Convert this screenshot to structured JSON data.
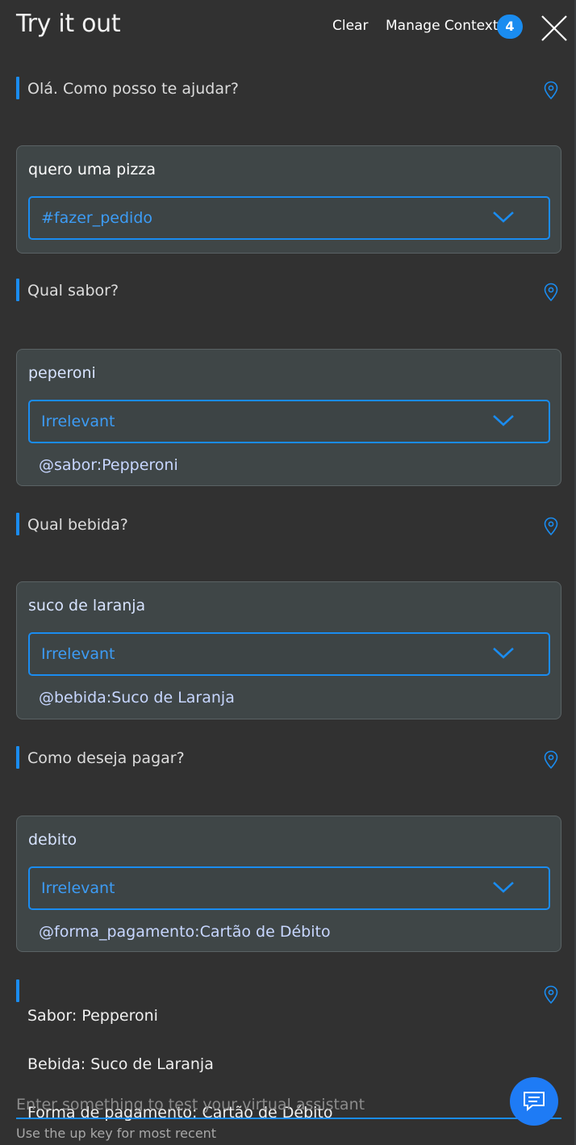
{
  "header": {
    "title": "Try it out",
    "clear_label": "Clear",
    "manage_context_label": "Manage Context",
    "context_count": "4"
  },
  "conversation": {
    "bot_messages": [
      "Olá. Como posso te ajudar?",
      "Qual sabor?",
      "Qual bebida?",
      "Como deseja pagar?"
    ],
    "user_inputs": [
      {
        "text": "quero uma pizza",
        "intent": "#fazer_pedido",
        "entity": ""
      },
      {
        "text": "peperoni",
        "intent": "Irrelevant",
        "entity": "@sabor:Pepperoni"
      },
      {
        "text": "suco de laranja",
        "intent": "Irrelevant",
        "entity": "@bebida:Suco de Laranja"
      },
      {
        "text": "debito",
        "intent": "Irrelevant",
        "entity": "@forma_pagamento:Cartão de Débito"
      }
    ],
    "summary": {
      "line1": "Sabor: Pepperoni",
      "line2": "Bebida: Suco de Laranja",
      "line3": "Forma de pagamento: Cartão de Débito"
    }
  },
  "composer": {
    "placeholder": "Enter something to test your virtual assistant",
    "hint": "Use the up key for most recent"
  },
  "colors": {
    "accent": "#1a8cf0",
    "background": "#313131",
    "card": "#3f4647"
  },
  "icons": {
    "close": "close-icon",
    "pin": "location-pin-icon",
    "chevron": "chevron-down-icon",
    "chat": "chat-bubble-icon"
  }
}
